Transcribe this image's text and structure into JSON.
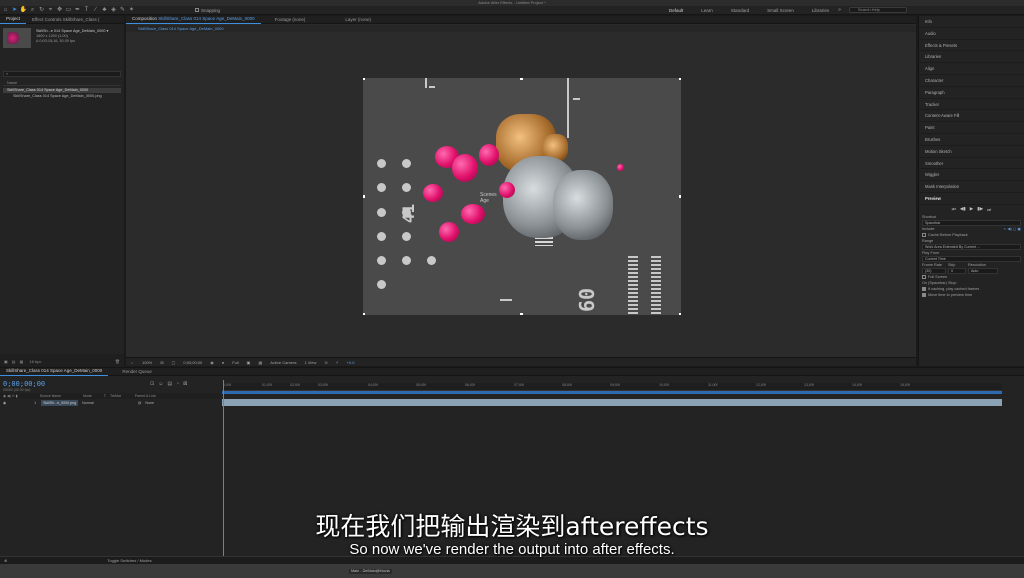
{
  "app": {
    "title": "Adobe After Effects - Untitled Project *"
  },
  "toolbar": {
    "snapping_label": "Snapping",
    "workspaces": [
      "Default",
      "Learn",
      "Standard",
      "Small Screen",
      "Libraries"
    ],
    "search_placeholder": "Search Help"
  },
  "project_panel": {
    "tabs": [
      "Project",
      "Effect Controls SkillShare_Class (",
      "Composition SkillShare_Class 014 Space Age_DeMain_0000"
    ],
    "item_title": "SkillSh...e 014 Space Age_DeMain_0000 ▾",
    "item_dims": "1600 x 1200 (1.00)",
    "item_duration": "Δ 0;00;15;16, 30.00 fps",
    "search_value": "",
    "column_name": "Name",
    "items": [
      "SkillShare_Class 014 Space Age_DeMain_0000",
      "SkillShare_Class 014 Space Age_DeMain_0000.png"
    ],
    "footer_bpc": "16 bpc"
  },
  "viewer": {
    "tabs": [
      {
        "prefix": "Composition",
        "name": "SkillShare_Class 014 Space Age_DeMain_0000"
      },
      {
        "prefix": "Footage",
        "name": "(none)"
      },
      {
        "prefix": "Layer",
        "name": "(none)"
      }
    ],
    "subtab": "SkillShare_Class 014 Space Age_DeMain_0000",
    "controls": {
      "zoom": "100%",
      "timecode": "0;00;00;00",
      "quality": "Full",
      "camera": "Active Camera",
      "views": "1 View",
      "exposure": "+0.0"
    },
    "comp_text": {
      "rot1": "41",
      "rot2": "60",
      "overlay": "Scenes Age"
    }
  },
  "right_panel": {
    "items": [
      "Info",
      "Audio",
      "Effects & Presets",
      "Libraries",
      "Align",
      "Character",
      "Paragraph",
      "Tracker",
      "Content-Aware Fill",
      "Paint",
      "Brushes",
      "Motion Sketch",
      "Smoother",
      "Wiggler",
      "Mask Interpolation",
      "Preview"
    ],
    "preview": {
      "transport": [
        "⏮",
        "◀▮",
        "▶",
        "▮▶",
        "⏭"
      ],
      "shortcut_label": "Shortcut",
      "shortcut_value": "Spacebar",
      "include_label": "Include:",
      "cache_label": "Cache Before Playback",
      "range_label": "Range",
      "range_value": "Work Area Extended By Current ...",
      "playfrom_label": "Play From",
      "playfrom_value": "Current Time",
      "framerate_label": "Frame Rate",
      "skip_label": "Skip",
      "resolution_label": "Resolution",
      "framerate_value": "(30)",
      "skip_value": "0",
      "resolution_value": "Auto",
      "fullscreen_label": "Full Screen",
      "stop_label": "On (Spacebar) Stop:",
      "stop_opt1": "If caching, play cached frames",
      "stop_opt2": "Move time to preview time"
    }
  },
  "timeline": {
    "tabs": [
      "SkillShare_Class 014 Space Age_DeMain_0000",
      "Render Queue"
    ],
    "timecode": "0;00;00;00",
    "timecode_sub": "00000 (30.00 fps)",
    "columns": [
      "Source Name",
      "Mode",
      "T",
      "TrkMat",
      "Parent & Link"
    ],
    "layer": {
      "index": "1",
      "name": "SkillSh...e_0000.png",
      "mode": "Normal",
      "parent": "None"
    },
    "ticks": [
      "0;00f",
      "01;00f",
      "02;00f",
      "03;00f",
      "04;00f",
      "05;00f",
      "06;00f",
      "07;00f",
      "08;00f",
      "09;00f",
      "10;00f",
      "11;00f",
      "12;00f",
      "13;00f",
      "14;00f",
      "15;00f"
    ],
    "toggle_label": "Toggle Switches / Modes"
  },
  "taskbar": {
    "item": "Main - DeMain@Mozia"
  },
  "subtitles": {
    "chinese": "现在我们把输出渲染到aftereffects",
    "english": "So now we've render the output into after effects."
  }
}
